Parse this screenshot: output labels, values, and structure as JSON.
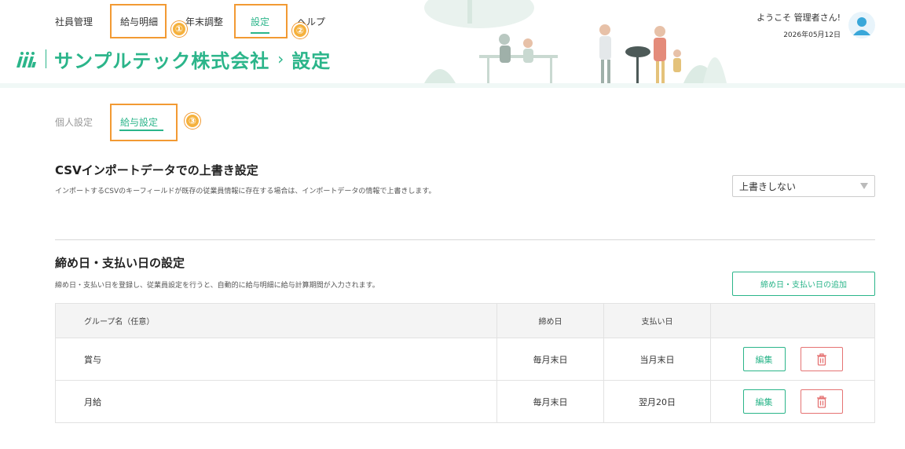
{
  "nav": {
    "items": [
      {
        "label": "社員管理"
      },
      {
        "label": "給与明細"
      },
      {
        "label": "年末調整"
      },
      {
        "label": "設定"
      },
      {
        "label": "ヘルプ"
      }
    ],
    "active_index": 3
  },
  "callouts": [
    "①",
    "②",
    "③"
  ],
  "brand": {
    "company": "サンプルテック株式会社",
    "separator": "›",
    "page": "設定"
  },
  "user": {
    "welcome": "ようこそ 管理者さん!",
    "date": "2026年05月12日",
    "avatar_icon": "user-avatar-icon"
  },
  "subtabs": [
    {
      "label": "個人設定"
    },
    {
      "label": "給与設定"
    }
  ],
  "csv_section": {
    "title": "CSVインポートデータでの上書き設定",
    "description": "インポートするCSVのキーフィールドが既存の従業員情報に存在する場合は、インポートデータの情報で上書きします。",
    "select_value": "上書きしない"
  },
  "closing_section": {
    "title": "締め日・支払い日の設定",
    "description": "締め日・支払い日を登録し、従業員設定を行うと、自動的に給与明細に給与計算期間が入力されます。",
    "add_button": "締め日・支払い日の追加",
    "table": {
      "headers": [
        "グループ名（任意）",
        "締め日",
        "支払い日",
        ""
      ],
      "rows": [
        {
          "group": "賞与",
          "closing": "毎月末日",
          "payment": "当月末日",
          "edit": "編集"
        },
        {
          "group": "月給",
          "closing": "毎月末日",
          "payment": "翌月20日",
          "edit": "編集"
        }
      ]
    }
  },
  "colors": {
    "accent": "#2bb58a",
    "highlight": "#f29a33",
    "badge": "#f5b13d",
    "danger": "#e57373"
  }
}
